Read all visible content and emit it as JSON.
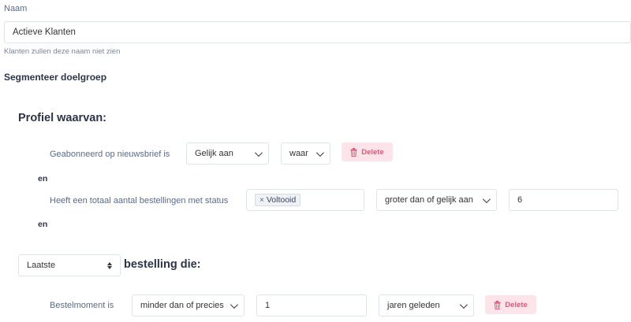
{
  "name_field": {
    "label": "Naam",
    "value": "Actieve Klanten",
    "hint": "Klanten zullen deze naam niet zien"
  },
  "segment": {
    "title": "Segmenteer doelgroep",
    "profile_heading": "Profiel waarvan:",
    "joiner": "en",
    "conditions": [
      {
        "label": "Geabonneerd op nieuwsbrief is",
        "operator": "Gelijk aan",
        "value": "waar",
        "delete_label": "Delete"
      },
      {
        "label": "Heeft een totaal aantal bestellingen met status",
        "tag": "Voltooid",
        "tag_remove": "×",
        "operator": "groter dan of gelijk aan",
        "value": "6"
      }
    ],
    "order": {
      "selector": "Laatste",
      "heading": "bestelling die:",
      "condition": {
        "label": "Bestelmoment is",
        "operator": "minder dan of precies",
        "value": "1",
        "unit": "jaren geleden",
        "delete_label": "Delete"
      }
    }
  },
  "icons": {
    "trash": "trash-icon",
    "chevron": "chevron-down-icon",
    "updown": "updown-arrows-icon"
  }
}
